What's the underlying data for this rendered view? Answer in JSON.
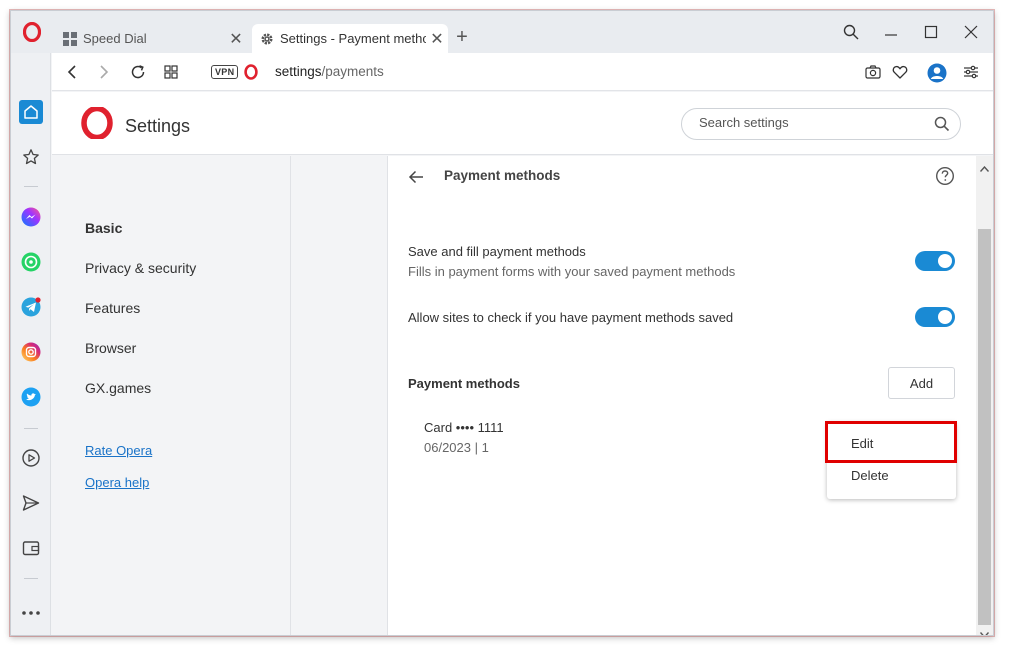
{
  "tabs": [
    {
      "title": "Speed Dial",
      "icon": "speed-dial-icon"
    },
    {
      "title": "Settings - Payment methods",
      "icon": "gear-icon"
    }
  ],
  "address_bar": {
    "vpn_label": "VPN",
    "url_host": "settings",
    "url_path": "/payments"
  },
  "settings_header": {
    "title": "Settings",
    "search_placeholder": "Search settings"
  },
  "nav": {
    "items": [
      "Basic",
      "Privacy & security",
      "Features",
      "Browser",
      "GX.games"
    ],
    "links": [
      "Rate Opera",
      "Opera help"
    ]
  },
  "content": {
    "heading": "Payment methods",
    "settings": [
      {
        "title": "Save and fill payment methods",
        "subtitle": "Fills in payment forms with your saved payment methods",
        "enabled": true
      },
      {
        "title": "Allow sites to check if you have payment methods saved",
        "enabled": true
      }
    ],
    "section_title": "Payment methods",
    "add_label": "Add",
    "card": {
      "name": "Card •••• 1111",
      "expiry": "06/2023 | 1"
    },
    "menu": {
      "edit": "Edit",
      "delete": "Delete"
    }
  },
  "colors": {
    "accent": "#1a8ad4",
    "opera_red": "#e0212e",
    "highlight": "#e00000",
    "link": "#1a73c8"
  }
}
